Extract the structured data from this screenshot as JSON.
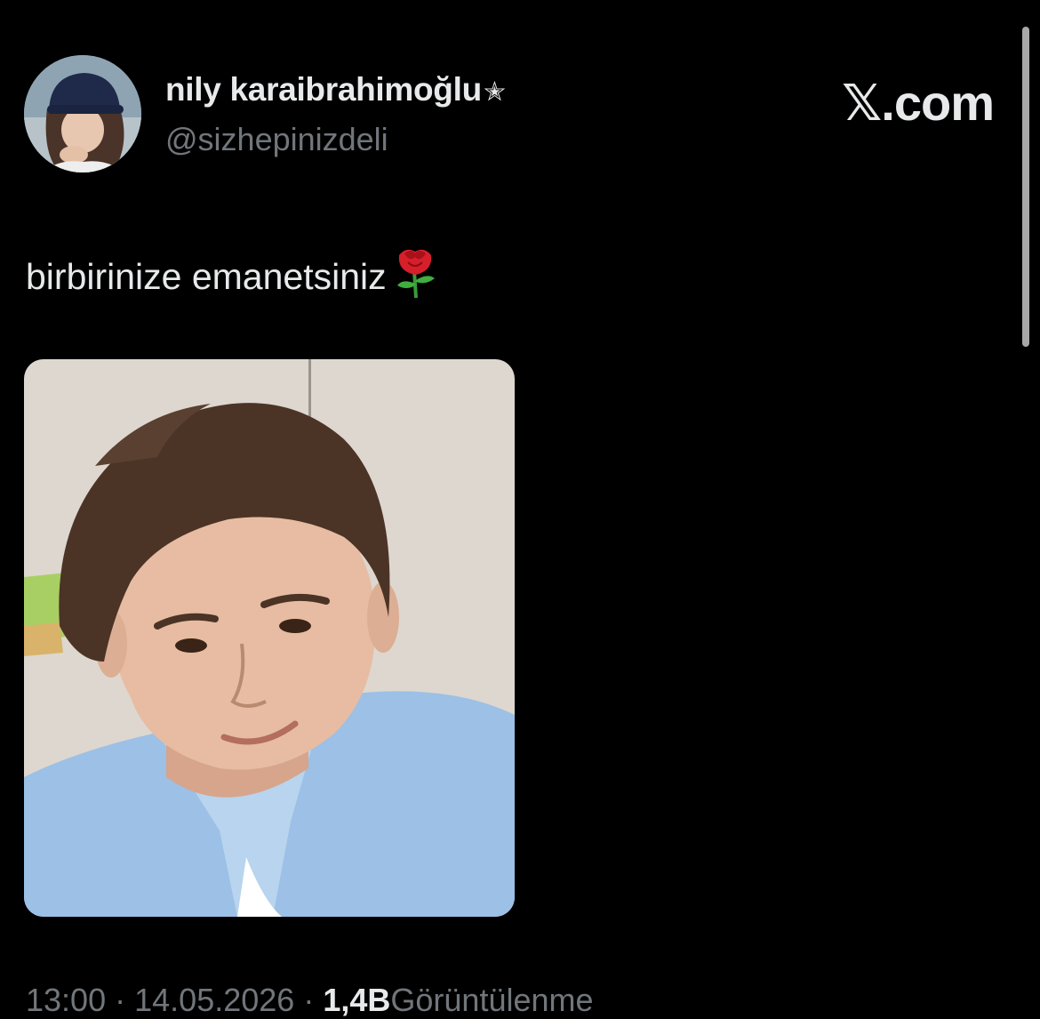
{
  "tweet": {
    "author": {
      "display_name": "nily karaibrahimoğlu",
      "badge_glyph": "✭",
      "handle": "@sizhepinizdeli"
    },
    "brand": "𝕏.com",
    "text": "birbirinize emanetsiniz",
    "emoji": "rose-emoji",
    "meta": {
      "time": "13:00",
      "separator": "·",
      "date": "14.05.2026",
      "views_count": "1,4B",
      "views_label": "Görüntülenme"
    }
  },
  "colors": {
    "background": "#000000",
    "primary_text": "#e7e9ea",
    "secondary_text": "#71767b"
  }
}
